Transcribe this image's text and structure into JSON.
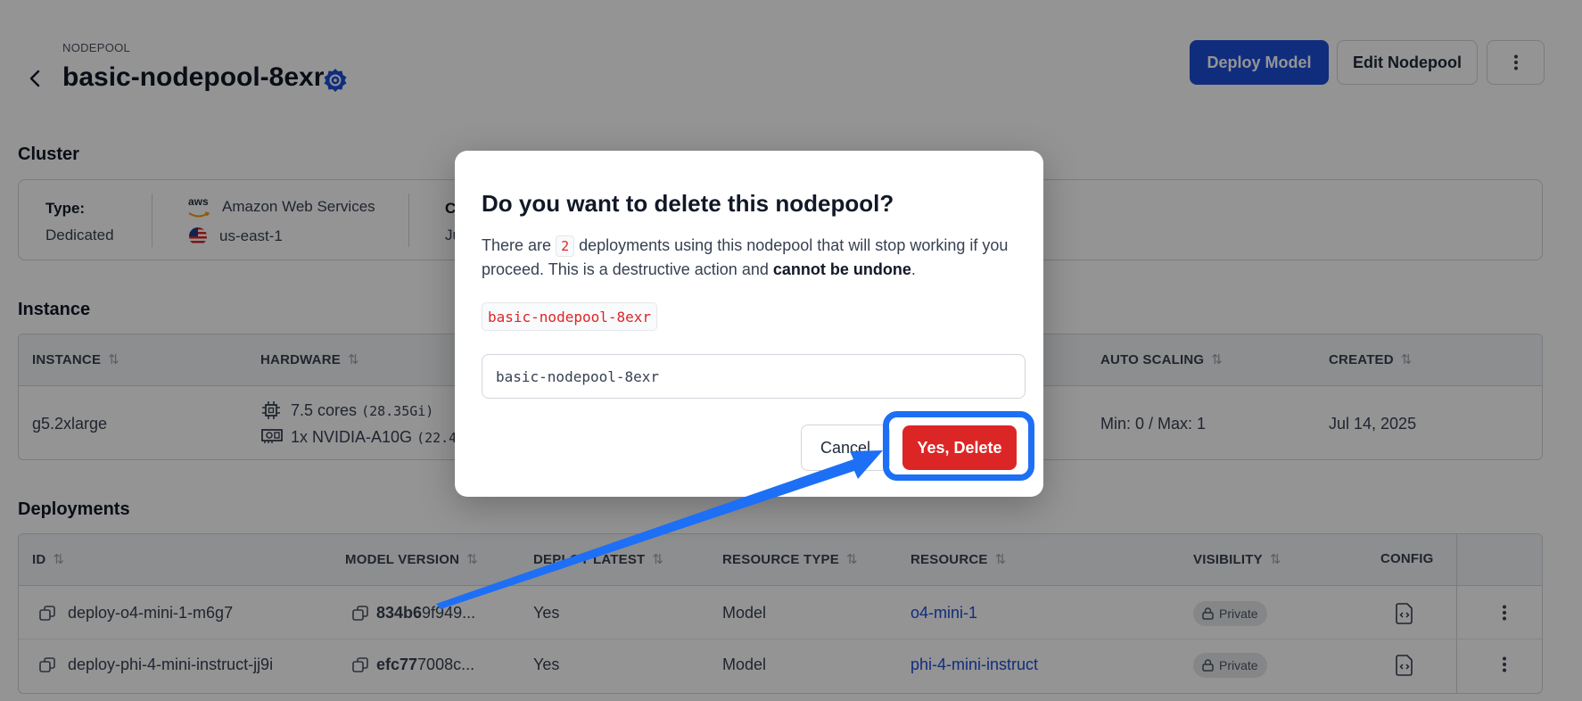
{
  "header": {
    "eyebrow": "NODEPOOL",
    "title": "basic-nodepool-8exr",
    "deploy_label": "Deploy Model",
    "edit_label": "Edit Nodepool"
  },
  "cluster": {
    "section_title": "Cluster",
    "type_label": "Type:",
    "type_value": "Dedicated",
    "provider": "Amazon Web Services",
    "provider_logo": "aws",
    "region": "us-east-1",
    "col3_label_partial": "C",
    "col3_value_partial": "Ju"
  },
  "instance": {
    "section_title": "Instance",
    "headers": [
      "INSTANCE",
      "HARDWARE",
      "AUTO SCALING",
      "CREATED"
    ],
    "row": {
      "instance": "g5.2xlarge",
      "cpu": "7.5 cores",
      "cpu_mem": "(28.35Gi)",
      "gpu": "1x NVIDIA-A10G",
      "gpu_mem": "(22.4",
      "autoscaling": "Min: 0 / Max: 1",
      "created": "Jul 14, 2025"
    }
  },
  "deployments": {
    "section_title": "Deployments",
    "headers": [
      "ID",
      "MODEL VERSION",
      "DEPLOY LATEST",
      "RESOURCE TYPE",
      "RESOURCE",
      "VISIBILITY",
      "CONFIG"
    ],
    "rows": [
      {
        "id": "deploy-o4-mini-1-m6g7",
        "version_bold": "834b6",
        "version_rest": "9f949...",
        "latest": "Yes",
        "type": "Model",
        "resource": "o4-mini-1",
        "visibility": "Private"
      },
      {
        "id": "deploy-phi-4-mini-instruct-jj9i",
        "version_bold": "efc77",
        "version_rest": "7008c...",
        "latest": "Yes",
        "type": "Model",
        "resource": "phi-4-mini-instruct",
        "visibility": "Private"
      }
    ]
  },
  "modal": {
    "title": "Do you want to delete this nodepool?",
    "body_pre": "There are",
    "count": "2",
    "body_mid": "deployments using this nodepool that will stop working if you proceed. This is a destructive action and",
    "body_bold": "cannot be undone",
    "body_end": ".",
    "nodepool_name": "basic-nodepool-8exr",
    "input_value": "basic-nodepool-8exr",
    "cancel_label": "Cancel",
    "delete_label": "Yes, Delete"
  },
  "colors": {
    "primary": "#1d4ed8",
    "danger": "#dc2626",
    "annotation": "#1d6ff5"
  }
}
